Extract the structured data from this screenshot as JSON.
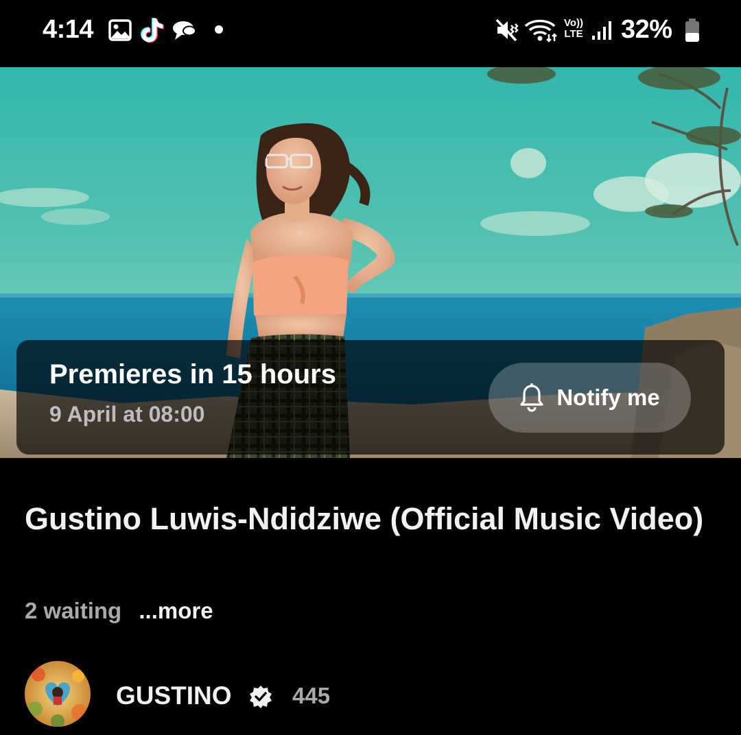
{
  "status_bar": {
    "time": "4:14",
    "notification_icons": [
      "gallery-icon",
      "tiktok-icon",
      "messages-icon",
      "more-notifications-dot-icon"
    ],
    "system_icons": [
      "mute-vibrate-icon",
      "wifi-icon",
      "volte-icon",
      "signal-icon",
      "battery-icon"
    ],
    "volte_line1": "Vo))",
    "volte_line2": "LTE",
    "battery_level": "32%"
  },
  "player": {
    "premiere_title": "Premieres in 15 hours",
    "premiere_date": "9 April at 08:00",
    "notify_label": "Notify me",
    "notify_icon": "bell-icon"
  },
  "video": {
    "title": "Gustino Luwis-Ndidziwe (Official Music Video)",
    "waiting": "2 waiting",
    "more_label": "...more"
  },
  "channel": {
    "name": "GUSTINO",
    "verified_icon": "verified-badge-icon",
    "subscriber_count": "445"
  },
  "colors": {
    "background": "#000000",
    "card_overlay": "rgba(0,0,0,0.66)",
    "secondary_text": "#aaaaaa"
  }
}
